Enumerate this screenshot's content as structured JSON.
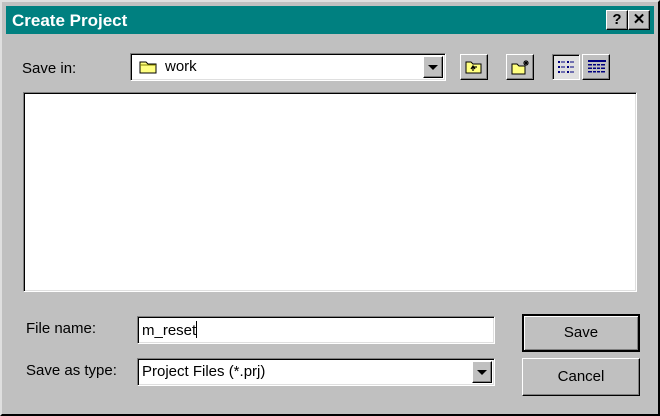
{
  "dialog": {
    "title": "Create Project",
    "help_button": "?",
    "close_button": "✕"
  },
  "save_in": {
    "label": "Save in:",
    "value": "work"
  },
  "toolbar": {
    "up_folder": "up-one-level",
    "new_folder": "create-new-folder",
    "list_view": "list",
    "details_view": "details"
  },
  "file_name": {
    "label": "File name:",
    "value": "m_reset"
  },
  "save_as_type": {
    "label": "Save as type:",
    "value": "Project Files (*.prj)"
  },
  "buttons": {
    "save": "Save",
    "cancel": "Cancel"
  }
}
